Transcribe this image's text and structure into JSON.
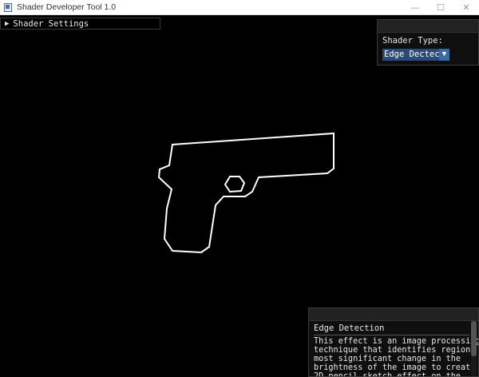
{
  "window": {
    "title": "Shader Developer Tool 1.0",
    "minimize": "—",
    "maximize": "☐",
    "close": "✕"
  },
  "settings_window": {
    "label": "Shader Settings",
    "arrow": "▶"
  },
  "shader_panel": {
    "label": "Shader Type:",
    "selected": "Edge Dectect",
    "arrow": "▼"
  },
  "description_panel": {
    "title": "Edge Detection",
    "body": "This effect is an image processing\ntechnique that identifies regions of\nmost significant change in the\nbrightness of the image to create a\n2D pencil sketch effect on the"
  },
  "colors": {
    "background": "#000000",
    "outline": "#ffffff",
    "dropdown": "#2a4a78"
  }
}
